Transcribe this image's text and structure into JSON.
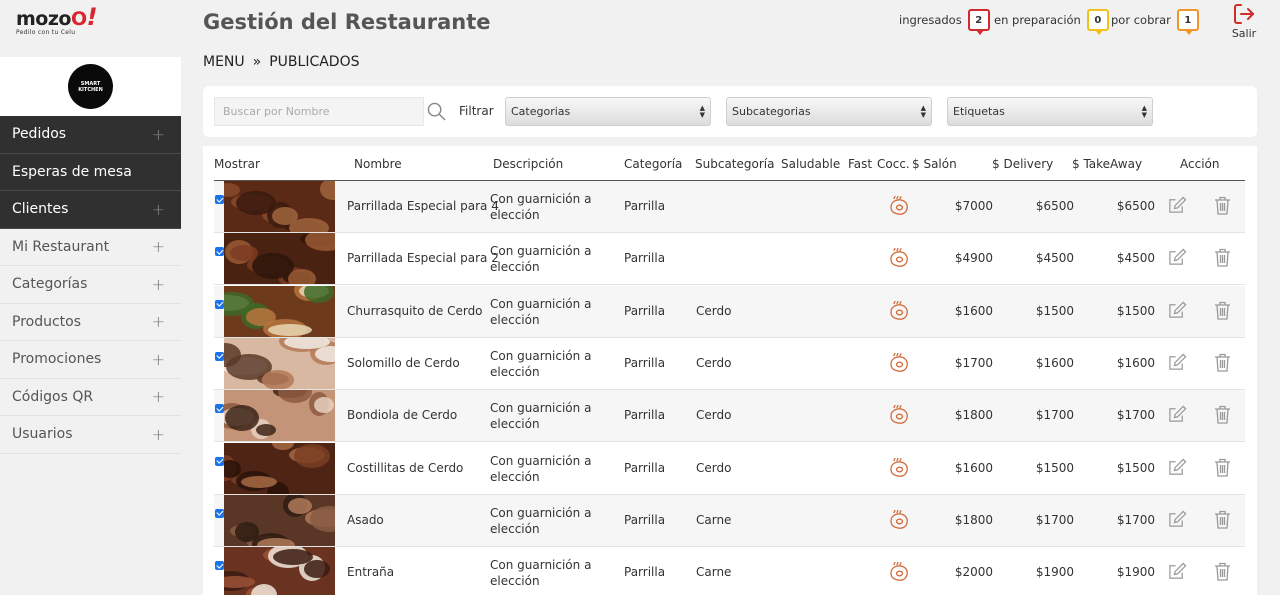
{
  "logo": {
    "brand": "mozo",
    "brand_accent": "O",
    "bang": "!",
    "tagline": "Pedilo con tu Celu"
  },
  "sidebar": {
    "restaurant_logo": "SMART KITCHEN",
    "items": [
      {
        "label": "Pedidos",
        "plus": "+",
        "dark": true
      },
      {
        "label": "Esperas de mesa",
        "plus": "",
        "dark": true
      },
      {
        "label": "Clientes",
        "plus": "+",
        "dark": true
      },
      {
        "label": "Mi Restaurant",
        "plus": "+",
        "dark": false
      },
      {
        "label": "Categorías",
        "plus": "+",
        "dark": false
      },
      {
        "label": "Productos",
        "plus": "+",
        "dark": false
      },
      {
        "label": "Promociones",
        "plus": "+",
        "dark": false
      },
      {
        "label": "Códigos QR",
        "plus": "+",
        "dark": false
      },
      {
        "label": "Usuarios",
        "plus": "+",
        "dark": false
      }
    ]
  },
  "header": {
    "title": "Gestión del Restaurante",
    "breadcrumb": [
      "MENU",
      "»",
      "PUBLICADOS"
    ],
    "status": [
      {
        "label": "ingresados",
        "count": "2",
        "color": "#d12b2b"
      },
      {
        "label": "en preparación",
        "count": "0",
        "color": "#f2c21b"
      },
      {
        "label": "por cobrar",
        "count": "1",
        "color": "#f0962a"
      }
    ],
    "logout_label": "Salir"
  },
  "filters": {
    "search_placeholder": "Buscar por Nombre",
    "filter_label": "Filtrar",
    "categories": "Categorias",
    "subcategories": "Subcategorias",
    "tags": "Etiquetas"
  },
  "table": {
    "headers": [
      "Mostrar",
      "Nombre",
      "Descripción",
      "Categoría",
      "Subcategoría",
      "Saludable",
      "Fast",
      "Cocc.",
      "$ Salón",
      "$ Delivery",
      "$ TakeAway",
      "Acción"
    ],
    "rows": [
      {
        "name": "Parrillada Especial para 4",
        "desc": "Con guarnición a elección",
        "category": "Parrilla",
        "subcategory": "",
        "salon": "$7000",
        "delivery": "$6500",
        "takeaway": "$6500"
      },
      {
        "name": "Parrillada Especial para 2",
        "desc": "Con guarnición a elección",
        "category": "Parrilla",
        "subcategory": "",
        "salon": "$4900",
        "delivery": "$4500",
        "takeaway": "$4500"
      },
      {
        "name": "Churrasquito de Cerdo",
        "desc": "Con guarnición a elección",
        "category": "Parrilla",
        "subcategory": "Cerdo",
        "salon": "$1600",
        "delivery": "$1500",
        "takeaway": "$1500"
      },
      {
        "name": "Solomillo de Cerdo",
        "desc": "Con guarnición a elección",
        "category": "Parrilla",
        "subcategory": "Cerdo",
        "salon": "$1700",
        "delivery": "$1600",
        "takeaway": "$1600"
      },
      {
        "name": "Bondiola de Cerdo",
        "desc": "Con guarnición a elección",
        "category": "Parrilla",
        "subcategory": "Cerdo",
        "salon": "$1800",
        "delivery": "$1700",
        "takeaway": "$1700"
      },
      {
        "name": "Costillitas de Cerdo",
        "desc": "Con guarnición a elección",
        "category": "Parrilla",
        "subcategory": "Cerdo",
        "salon": "$1600",
        "delivery": "$1500",
        "takeaway": "$1500"
      },
      {
        "name": "Asado",
        "desc": "Con guarnición a elección",
        "category": "Parrilla",
        "subcategory": "Carne",
        "salon": "$1800",
        "delivery": "$1700",
        "takeaway": "$1700"
      },
      {
        "name": "Entraña",
        "desc": "Con guarnición a elección",
        "category": "Parrilla",
        "subcategory": "Carne",
        "salon": "$2000",
        "delivery": "$1900",
        "takeaway": "$1900"
      }
    ]
  },
  "icons": {
    "cooking": "steak-icon",
    "edit": "edit-icon",
    "delete": "trash-icon",
    "accent": "#d26a3a"
  }
}
